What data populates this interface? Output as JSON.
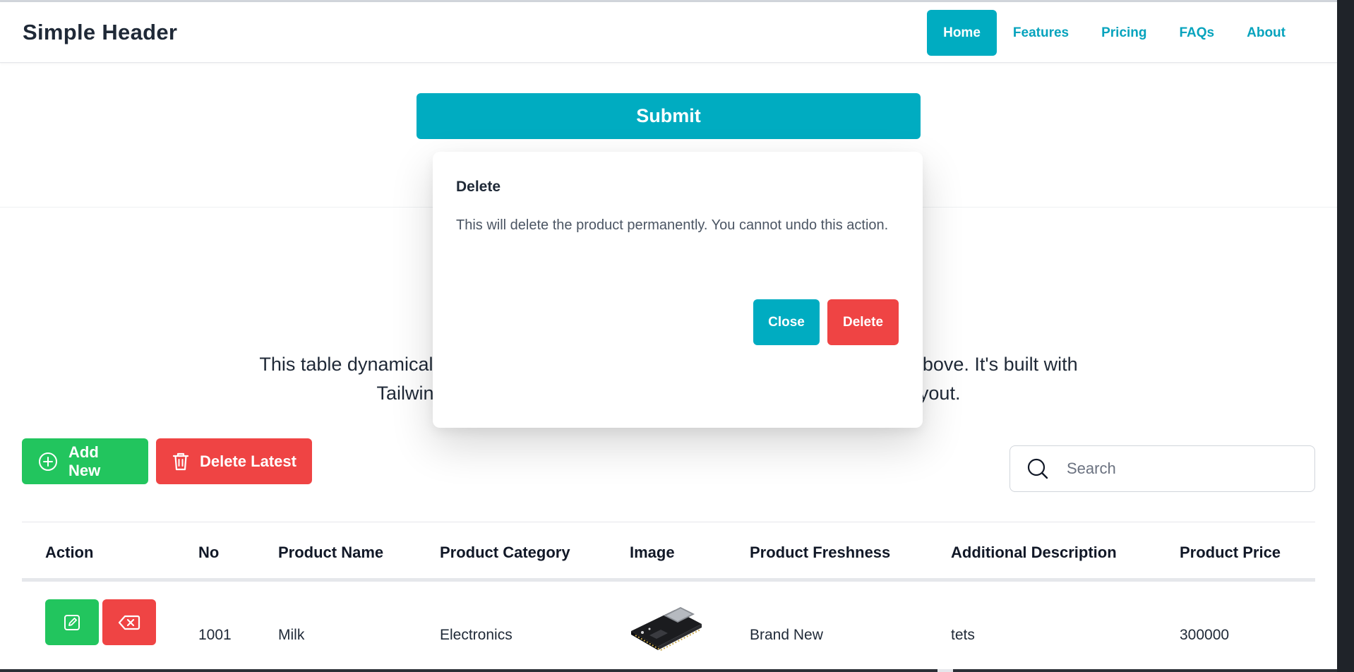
{
  "header": {
    "brand": "Simple Header",
    "nav": [
      "Home",
      "Features",
      "Pricing",
      "FAQs",
      "About"
    ],
    "active_nav": "Home"
  },
  "form": {
    "submit_label": "Submit"
  },
  "intro": {
    "description": "This table dynamically displays the product data you submit through the form above. It's built with Tailwind CSS for a clean, responsive, and easily customizable layout."
  },
  "toolbar": {
    "add_label": "Add New",
    "delete_label": "Delete Latest",
    "search_placeholder": "Search"
  },
  "table": {
    "headers": [
      "Action",
      "No",
      "Product Name",
      "Product Category",
      "Image",
      "Product Freshness",
      "Additional Description",
      "Product Price"
    ],
    "rows": [
      {
        "no": "1001",
        "name": "Milk",
        "category": "Electronics",
        "image": "microcontroller-board-image",
        "freshness": "Brand New",
        "description": "tets",
        "price": "300000"
      }
    ]
  },
  "modal": {
    "title": "Delete",
    "message": "This will delete the product permanently. You cannot undo this action.",
    "close_label": "Close",
    "delete_label": "Delete"
  },
  "colors": {
    "primary": "#00acc1",
    "success": "#22c55e",
    "danger": "#ef4444",
    "text": "#1f2937"
  }
}
